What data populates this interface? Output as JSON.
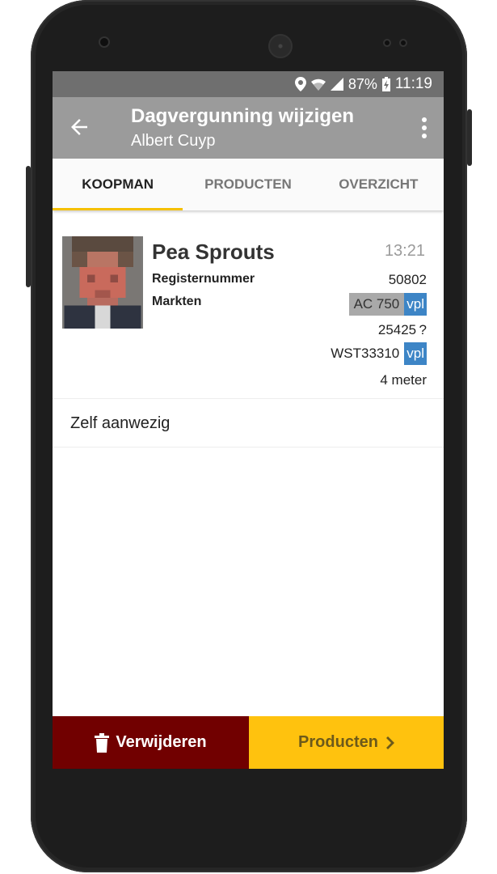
{
  "status_bar": {
    "battery": "87%",
    "time": "11:19"
  },
  "app_bar": {
    "title": "Dagvergunning wijzigen",
    "subtitle": "Albert Cuyp"
  },
  "tabs": [
    {
      "label": "KOOPMAN",
      "active": true
    },
    {
      "label": "PRODUCTEN",
      "active": false
    },
    {
      "label": "OVERZICHT",
      "active": false
    }
  ],
  "koopman": {
    "name": "Pea Sprouts",
    "time": "13:21",
    "registernummer_label": "Registernummer",
    "registernummer": "50802",
    "markten_label": "Markten",
    "markten": [
      {
        "code": "AC 750",
        "tag": "vpl"
      },
      {
        "code": "25425 ?",
        "tag": ""
      },
      {
        "code": "WST33310",
        "tag": "vpl"
      }
    ],
    "length": "4 meter"
  },
  "presence": "Zelf aanwezig",
  "bottom": {
    "delete_label": "Verwijderen",
    "next_label": "Producten"
  },
  "colors": {
    "accent": "#f5c000",
    "delete": "#710000",
    "next": "#ffc20e",
    "tag": "#3d85c6"
  }
}
